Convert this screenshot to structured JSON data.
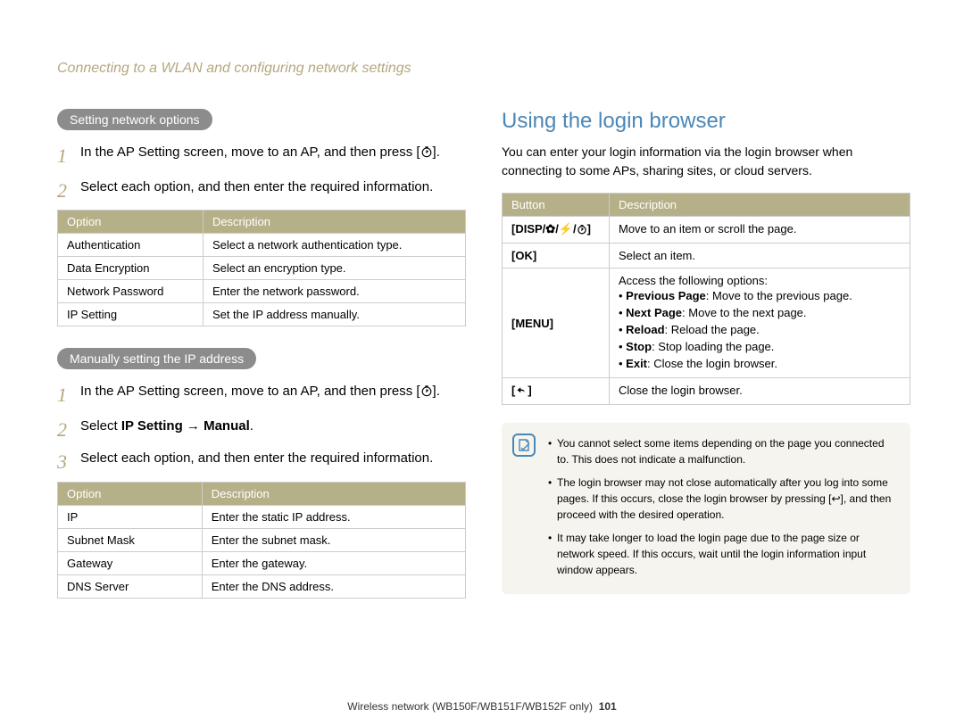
{
  "breadcrumb": "Connecting to a WLAN and configuring network settings",
  "left": {
    "section1": {
      "title": "Setting network options",
      "steps": [
        "In the AP Setting screen, move to an AP, and then press [",
        "Select each option, and then enter the required information."
      ],
      "step1_tail": "].",
      "table": {
        "h1": "Option",
        "h2": "Description",
        "rows": [
          {
            "o": "Authentication",
            "d": "Select a network authentication type."
          },
          {
            "o": "Data Encryption",
            "d": "Select an encryption type."
          },
          {
            "o": "Network Password",
            "d": "Enter the network password."
          },
          {
            "o": "IP Setting",
            "d": "Set the IP address manually."
          }
        ]
      }
    },
    "section2": {
      "title": "Manually setting the IP address",
      "steps": [
        "In the AP Setting screen, move to an AP, and then press [",
        "Select ",
        "Select each option, and then enter the required information."
      ],
      "step1_tail": "].",
      "step2_bold": "IP Setting → Manual",
      "step2_tail": ".",
      "table": {
        "h1": "Option",
        "h2": "Description",
        "rows": [
          {
            "o": "IP",
            "d": "Enter the static IP address."
          },
          {
            "o": "Subnet Mask",
            "d": "Enter the subnet mask."
          },
          {
            "o": "Gateway",
            "d": "Enter the gateway."
          },
          {
            "o": "DNS Server",
            "d": "Enter the DNS address."
          }
        ]
      }
    }
  },
  "right": {
    "title": "Using the login browser",
    "intro": "You can enter your login information via the login browser when connecting to some APs, sharing sites, or cloud servers.",
    "table": {
      "h1": "Button",
      "h2": "Description",
      "rows": {
        "disp": {
          "label": "[DISP/",
          "tail": "]",
          "desc": "Move to an item or scroll the page."
        },
        "ok": {
          "label": "[OK]",
          "desc": "Select an item."
        },
        "menu": {
          "label": "[MENU]",
          "desc_intro": "Access the following options:",
          "items": [
            {
              "b": "Previous Page",
              "t": ": Move to the previous page."
            },
            {
              "b": "Next Page",
              "t": ": Move to the next page."
            },
            {
              "b": "Reload",
              "t": ": Reload the page."
            },
            {
              "b": "Stop",
              "t": ": Stop loading the page."
            },
            {
              "b": "Exit",
              "t": ": Close the login browser."
            }
          ]
        },
        "back": {
          "desc": "Close the login browser."
        }
      }
    },
    "notes": [
      "You cannot select some items depending on the page you connected to. This does not indicate a malfunction.",
      "The login browser may not close automatically after you log into some pages. If this occurs, close the login browser by pressing [↩], and then proceed with the desired operation.",
      "It may take longer to load the login page due to the page size or network speed. If this occurs, wait until the login information input window appears."
    ]
  },
  "footer": {
    "text": "Wireless network (WB150F/WB151F/WB152F only)",
    "page": "101"
  }
}
